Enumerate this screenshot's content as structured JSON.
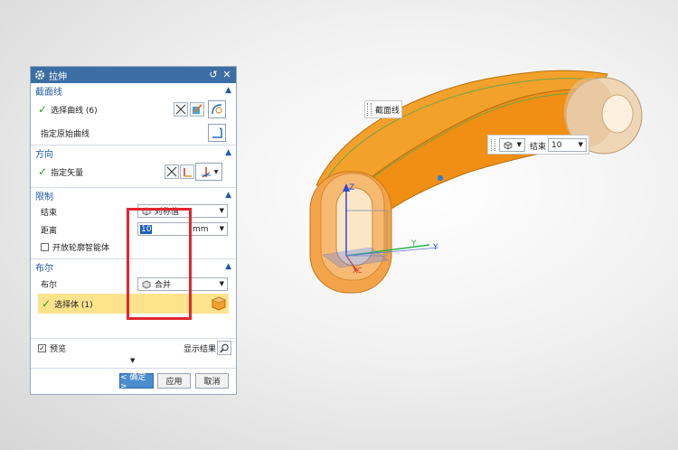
{
  "dialog": {
    "title": "拉伸",
    "reset_icon": "↺",
    "close_icon": "✕",
    "sections": {
      "section_curve": {
        "title": "截面线",
        "select_curve_label": "选择曲线 (6)",
        "specify_origin_label": "指定原始曲线"
      },
      "direction": {
        "title": "方向",
        "specify_vector_label": "指定矢量"
      },
      "limits": {
        "title": "限制",
        "end_label": "结束",
        "end_value": "对称值",
        "distance_label": "距离",
        "distance_value": "10",
        "distance_unit": "mm",
        "open_profile_label": "开放轮廓智能体"
      },
      "boolean": {
        "title": "布尔",
        "boolean_label": "布尔",
        "boolean_value": "合并",
        "select_body_label": "选择体 (1)"
      }
    },
    "preview_label": "预览",
    "show_result_label": "显示结果",
    "ok_label": "< 确定 >",
    "apply_label": "应用",
    "cancel_label": "取消"
  },
  "viewport": {
    "section_tag": "截面线",
    "float_end_label": "结束",
    "float_end_value": "10",
    "axes": {
      "z": "Z",
      "y": "Y",
      "x": "XC"
    }
  },
  "colors": {
    "titlebar": "#3b6ea5",
    "section_header": "#1f5aa8",
    "model_orange": "#f2991e",
    "highlight_row": "#fde38c",
    "red_box": "#e0262c"
  }
}
